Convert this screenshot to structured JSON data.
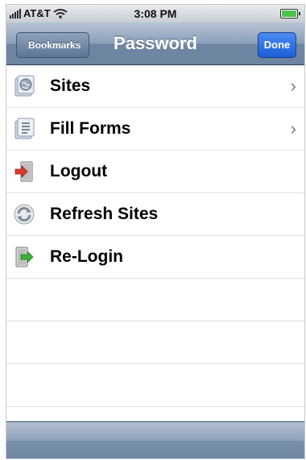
{
  "status_bar": {
    "carrier": "AT&T",
    "time": "3:08 PM"
  },
  "nav": {
    "back_label": "Bookmarks",
    "title": "Password",
    "done_label": "Done"
  },
  "menu": {
    "items": [
      {
        "label": "Sites",
        "icon": "globe-icon",
        "has_chevron": true
      },
      {
        "label": "Fill Forms",
        "icon": "forms-icon",
        "has_chevron": true
      },
      {
        "label": "Logout",
        "icon": "logout-icon",
        "has_chevron": false
      },
      {
        "label": "Refresh Sites",
        "icon": "refresh-icon",
        "has_chevron": false
      },
      {
        "label": "Re-Login",
        "icon": "relogin-icon",
        "has_chevron": false
      }
    ]
  },
  "colors": {
    "nav_bar": "#8a9fb8",
    "done_button": "#1c5fd8",
    "logout_arrow": "#d83a2e",
    "relogin_arrow": "#3fae35"
  }
}
